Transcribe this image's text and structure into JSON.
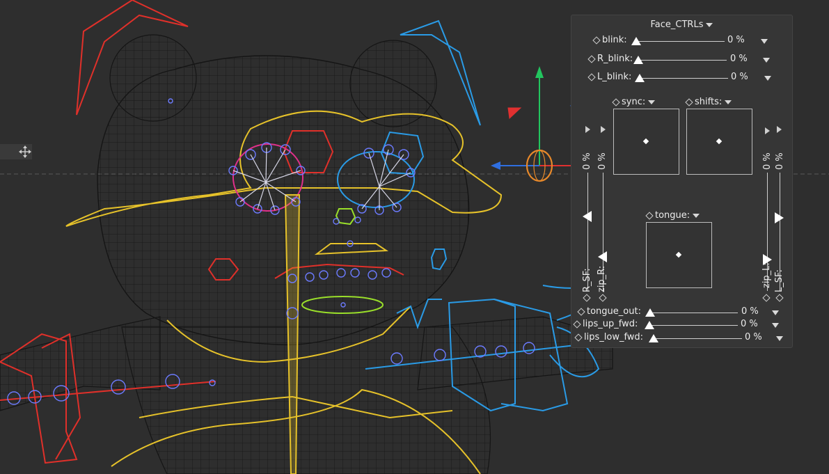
{
  "panel": {
    "title": "Face_CTRLs",
    "sliders_top": [
      {
        "label": "blink:",
        "value": "0 %"
      },
      {
        "label": "R_blink:",
        "value": "0 %"
      },
      {
        "label": "L_blink:",
        "value": "0 %"
      }
    ],
    "sync_label": "sync:",
    "shifts_label": "shifts:",
    "tongue_label": "tongue:",
    "vertical": {
      "left_pct_a": "0 %",
      "left_pct_b": "0 %",
      "right_pct_a": "0 %",
      "right_pct_b": "0 %",
      "r_sf": "R_SF:",
      "zip_r": "zip_R:",
      "zip_l": "zip_L:",
      "l_sf": "L_SF:"
    },
    "sliders_bottom": [
      {
        "label": "tongue_out:",
        "value": "0 %"
      },
      {
        "label": "lips_up_fwd:",
        "value": "0 %"
      },
      {
        "label": "lips_low_fwd:",
        "value": "0 %"
      }
    ]
  },
  "colors": {
    "background": "#2e2e2e",
    "wire": "#161616",
    "ctrl_yellow": "#e6c22a",
    "ctrl_red": "#e0302a",
    "ctrl_blue": "#2a9be6",
    "ctrl_magenta": "#e0308a",
    "ctrl_green": "#9adf2a",
    "axis_green": "#22c55e",
    "axis_red": "#e03030",
    "axis_blue": "#2f6fe0"
  }
}
